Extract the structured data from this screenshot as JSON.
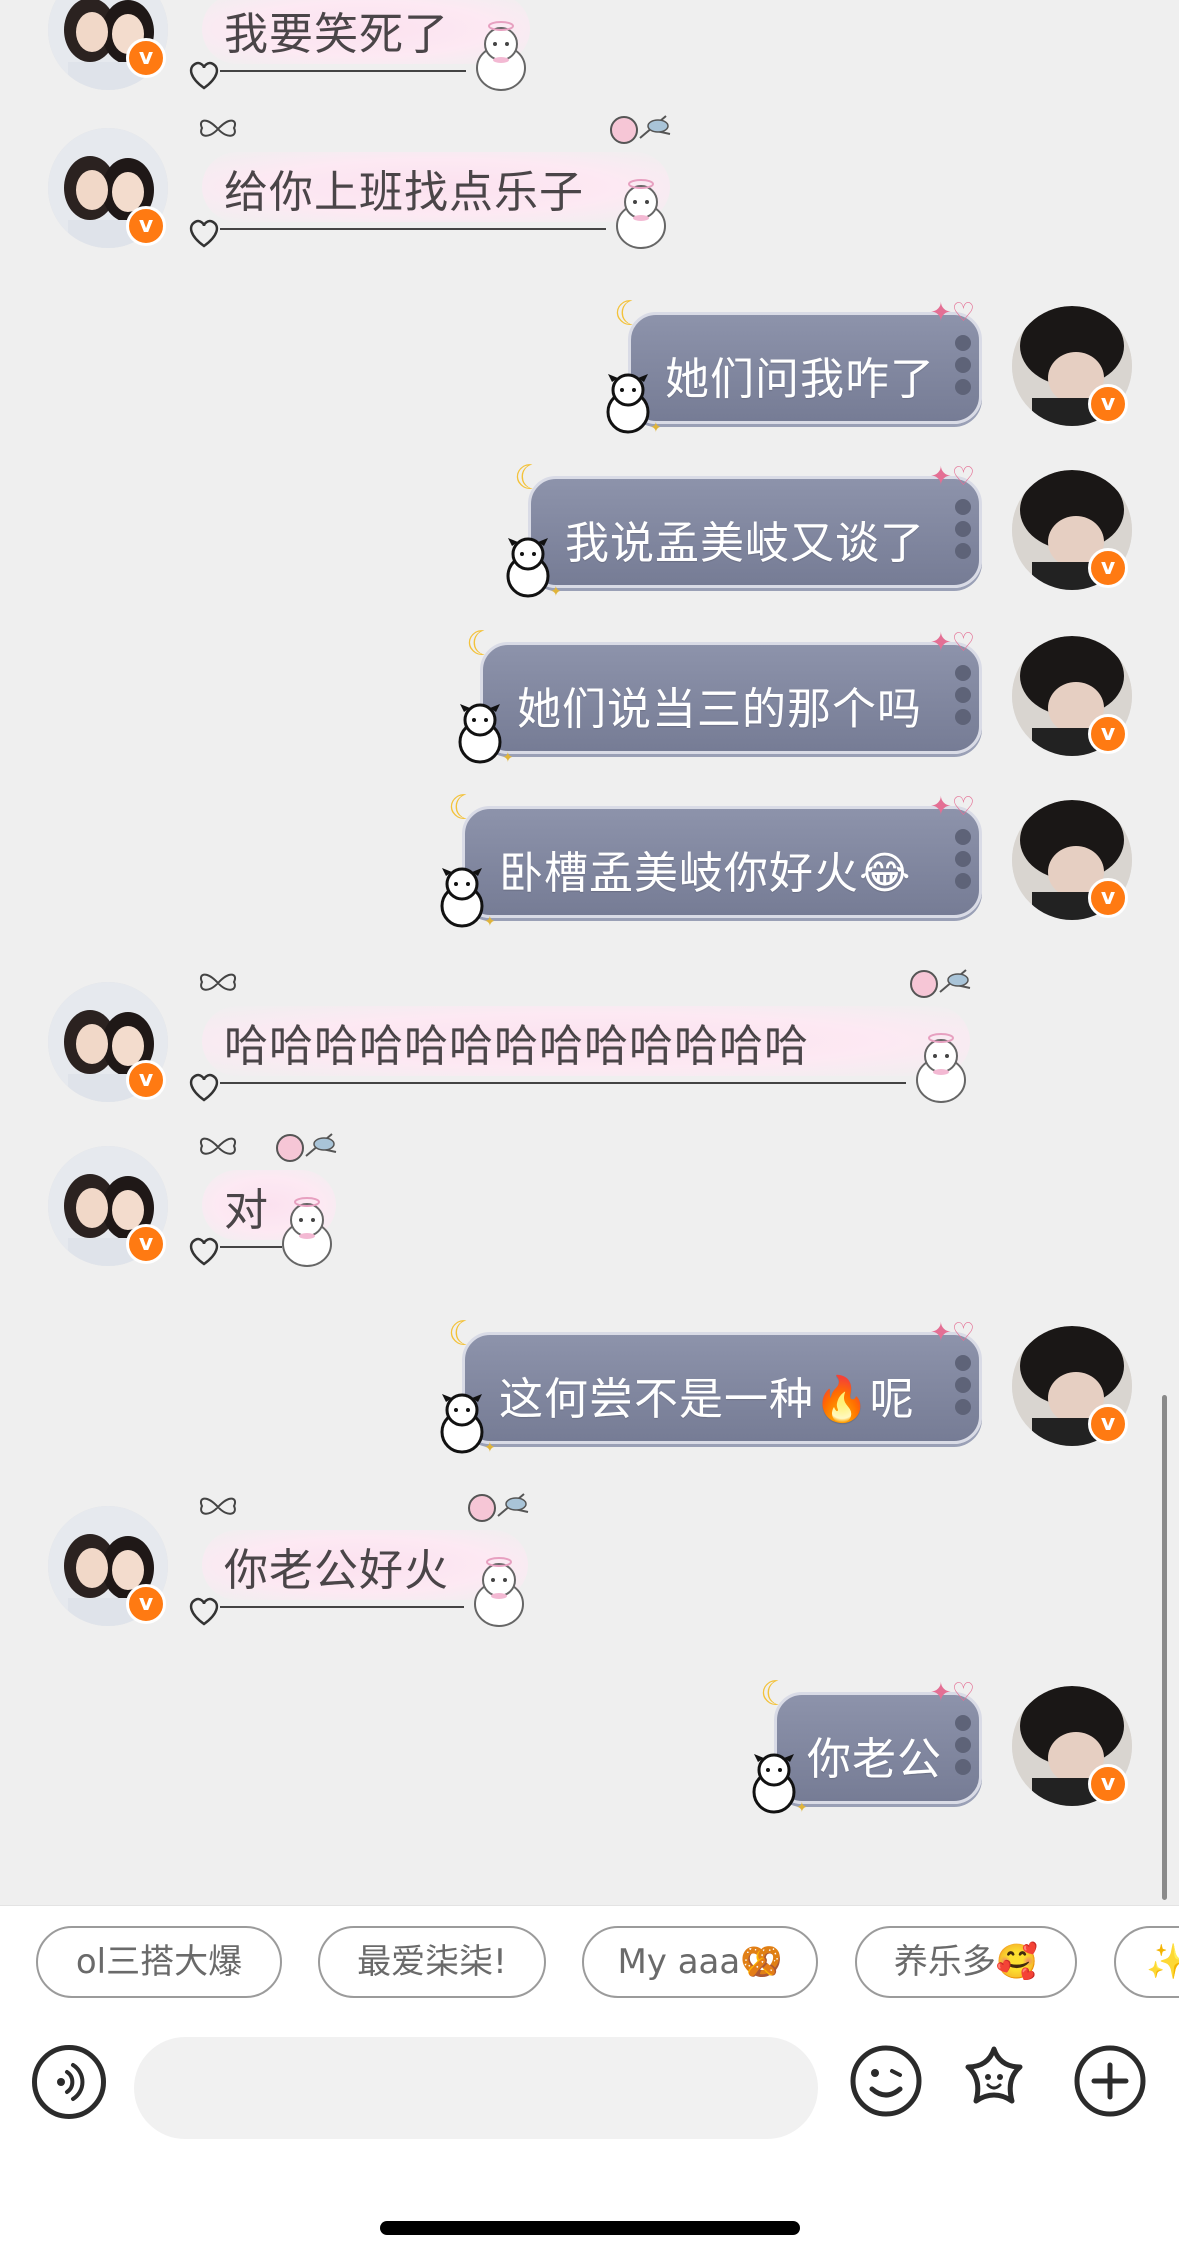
{
  "messages": [
    {
      "side": "in",
      "text": "我要笑死了"
    },
    {
      "side": "in",
      "text": "给你上班找点乐子"
    },
    {
      "side": "out",
      "text": "她们问我咋了"
    },
    {
      "side": "out",
      "text": "我说孟美岐又谈了"
    },
    {
      "side": "out",
      "text": "她们说当三的那个吗"
    },
    {
      "side": "out",
      "text": "卧槽孟美岐你好火😂"
    },
    {
      "side": "in",
      "text": "哈哈哈哈哈哈哈哈哈哈哈哈哈"
    },
    {
      "side": "in",
      "text": "对"
    },
    {
      "side": "out",
      "text": "这何尝不是一种🔥呢"
    },
    {
      "side": "in",
      "text": "你老公好火"
    },
    {
      "side": "out",
      "text": "你老公"
    }
  ],
  "badges": {
    "verified": "v"
  },
  "quick_replies": [
    "ol三搭大爆",
    "最爱柒柒!",
    "My aaa🥨",
    "养乐多🥰",
    "✨"
  ],
  "input": {
    "placeholder": ""
  },
  "icons": {
    "voice": "voice-icon",
    "emoji": "emoji-face-icon",
    "sticker": "star-sticker-icon",
    "more": "plus-icon"
  },
  "colors": {
    "background": "#efefef",
    "incoming_bubble": "#fde9f3",
    "outgoing_bubble": "#7f859d",
    "badge": "#ff7a12"
  }
}
